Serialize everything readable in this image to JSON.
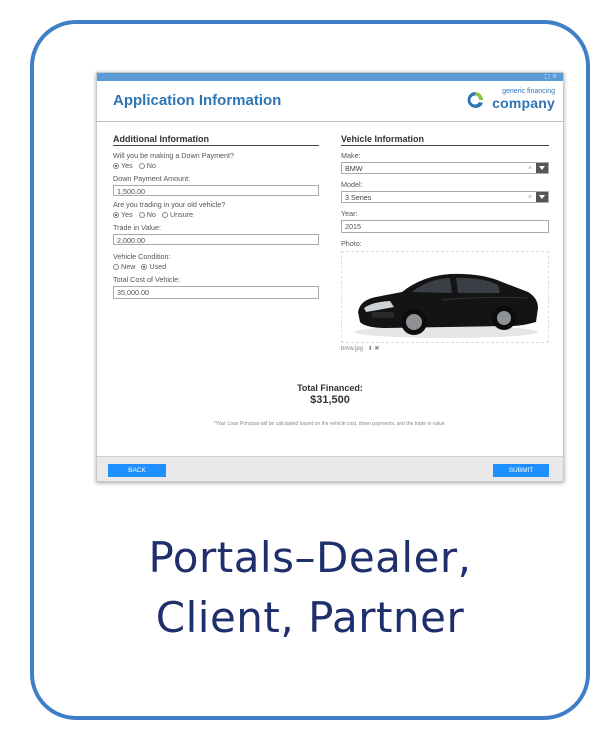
{
  "window": {
    "controls": "□ ✕"
  },
  "header": {
    "title": "Application Information",
    "logo_small": "generic financing",
    "logo_big": "company"
  },
  "additional": {
    "section_title": "Additional Information",
    "down_payment_question": "Will you be making a Down Payment?",
    "down_payment_options": [
      "Yes",
      "No"
    ],
    "down_payment_selected": "Yes",
    "down_payment_amount_label": "Down Payment Amount:",
    "down_payment_amount_value": "1,500.00",
    "trade_question": "Are you trading in your old vehicle?",
    "trade_options": [
      "Yes",
      "No",
      "Unsure"
    ],
    "trade_selected": "Yes",
    "trade_value_label": "Trade in Value:",
    "trade_value_value": "2,000.00",
    "condition_label": "Vehicle Condition:",
    "condition_options": [
      "New",
      "Used"
    ],
    "condition_selected": "Used",
    "total_cost_label": "Total Cost of Vehicle:",
    "total_cost_value": "35,000.00"
  },
  "vehicle": {
    "section_title": "Vehicle Information",
    "make_label": "Make:",
    "make_value": "BMW",
    "model_label": "Model:",
    "model_value": "3 Series",
    "year_label": "Year:",
    "year_value": "2015",
    "photo_label": "Photo:",
    "photo_filename": "bmw.jpg",
    "clear_glyph": "×",
    "photo_actions": "⬇ ✖"
  },
  "summary": {
    "total_label": "Total Financed:",
    "total_value": "$31,500",
    "note": "*Your Loan Principal will be calculated based on the vehicle cost, down payments, and the trade in value."
  },
  "footer": {
    "back_label": "BACK",
    "submit_label": "SUBMIT"
  },
  "caption": {
    "line1": "Portals–Dealer,",
    "line2": "Client, Partner"
  },
  "colors": {
    "accent": "#2e75b6",
    "button": "#1e90ff",
    "border": "#3f7fc7",
    "caption": "#1f2f6b"
  }
}
